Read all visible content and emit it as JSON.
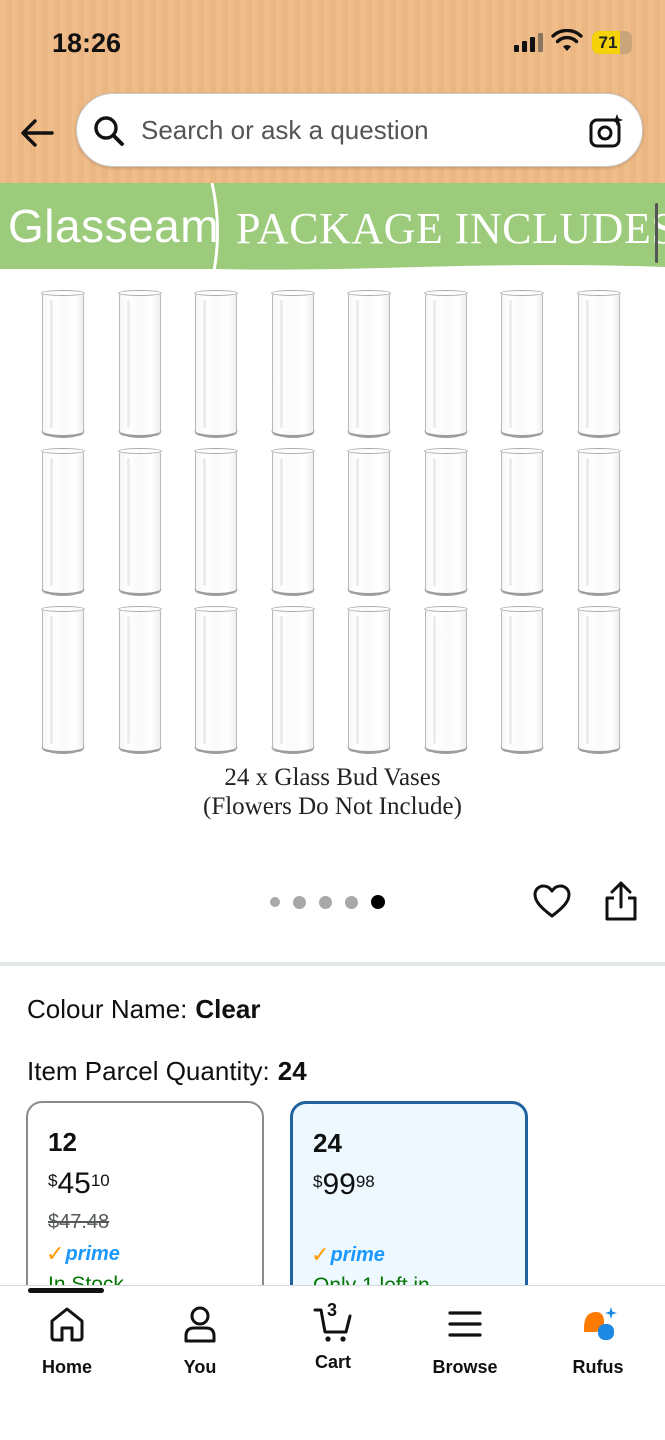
{
  "status_bar": {
    "time": "18:26",
    "battery": "71",
    "battery_level": 0.71
  },
  "search": {
    "placeholder": "Search or ask a question"
  },
  "product_image": {
    "brand": "Glasseam",
    "banner_title": "PACKAGE INCLUDES",
    "caption_line1": "24 x Glass Bud Vases",
    "caption_line2": "(Flowers Do Not Include)",
    "vase_count": 24,
    "image_count": 5,
    "active_image": 5
  },
  "attributes": {
    "colour_label": "Colour Name:",
    "colour_value": "Clear",
    "qty_label": "Item Parcel Quantity:",
    "qty_value": "24"
  },
  "options": [
    {
      "qty": "12",
      "price_whole": "45",
      "price_cents": "10",
      "currency": "$",
      "was": "$47.48",
      "prime": "prime",
      "stock": "In Stock",
      "selected": false
    },
    {
      "qty": "24",
      "price_whole": "99",
      "price_cents": "98",
      "currency": "$",
      "was": "",
      "prime": "prime",
      "stock": "Only 1 left in",
      "selected": true
    }
  ],
  "bottom_nav": {
    "items": [
      {
        "label": "Home",
        "icon": "home-icon"
      },
      {
        "label": "You",
        "icon": "person-icon"
      },
      {
        "label": "Cart",
        "icon": "cart-icon",
        "badge": "3"
      },
      {
        "label": "Browse",
        "icon": "menu-icon"
      },
      {
        "label": "Rufus",
        "icon": "rufus-icon"
      }
    ]
  },
  "colors": {
    "header_bg": "#efbd89",
    "banner_green": "#9ccb7b",
    "prime_blue": "#1a98ff",
    "selected_border": "#2162a1",
    "stock_green": "#007600"
  }
}
